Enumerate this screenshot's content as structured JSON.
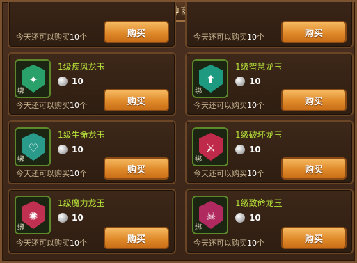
{
  "shop": {
    "title": "女神商店",
    "buy_label": "购买",
    "limit_prefix": "今天还可以购买",
    "limit_count": "10",
    "limit_suffix": "个",
    "bind_tag": "绑"
  },
  "items": [
    {
      "name": "1级疾风龙玉",
      "price": "10",
      "icon": "wind-jade-icon",
      "color": "#2aa06a",
      "glyph": "✦"
    },
    {
      "name": "1级智慧龙玉",
      "price": "10",
      "icon": "wisdom-jade-icon",
      "color": "#1e9a80",
      "glyph": "⬆"
    },
    {
      "name": "1级生命龙玉",
      "price": "10",
      "icon": "life-jade-icon",
      "color": "#2a9a8a",
      "glyph": "♡"
    },
    {
      "name": "1级破坏龙玉",
      "price": "10",
      "icon": "destruction-jade-icon",
      "color": "#c02a4a",
      "glyph": "⚔"
    },
    {
      "name": "1级魔力龙玉",
      "price": "10",
      "icon": "magic-jade-icon",
      "color": "#c03050",
      "glyph": "✺"
    },
    {
      "name": "1级致命龙玉",
      "price": "10",
      "icon": "fatal-jade-icon",
      "color": "#b02a60",
      "glyph": "☠"
    }
  ]
}
